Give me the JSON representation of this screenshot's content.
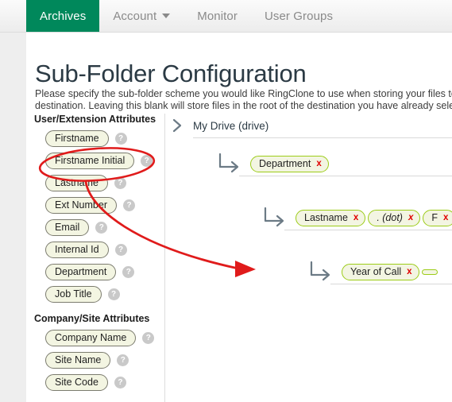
{
  "nav": {
    "items": [
      {
        "label": "Archives",
        "active": true,
        "has_caret": false
      },
      {
        "label": "Account",
        "active": false,
        "has_caret": true
      },
      {
        "label": "Monitor",
        "active": false,
        "has_caret": false
      },
      {
        "label": "User Groups",
        "active": false,
        "has_caret": false
      }
    ],
    "active_color": "#00885b"
  },
  "page": {
    "title": "Sub-Folder Configuration",
    "description": "Please specify the sub-folder scheme you would like RingClone to use when storing your files to your destination. Leaving this blank will store files in the root of the destination you have already selected."
  },
  "sidebar": {
    "groups": [
      {
        "title": "User/Extension Attributes",
        "items": [
          {
            "label": "Firstname",
            "help": "?"
          },
          {
            "label": "Firstname Initial",
            "help": "?"
          },
          {
            "label": "Lastname",
            "help": "?"
          },
          {
            "label": "Ext Number",
            "help": "?"
          },
          {
            "label": "Email",
            "help": "?"
          },
          {
            "label": "Internal Id",
            "help": "?"
          },
          {
            "label": "Department",
            "help": "?"
          },
          {
            "label": "Job Title",
            "help": "?"
          }
        ]
      },
      {
        "title": "Company/Site Attributes",
        "items": [
          {
            "label": "Company Name",
            "help": "?"
          },
          {
            "label": "Site Name",
            "help": "?"
          },
          {
            "label": "Site Code",
            "help": "?"
          }
        ]
      }
    ]
  },
  "tree": {
    "root": {
      "label": "My Drive (drive)"
    },
    "rows": [
      {
        "tags": [
          {
            "label": "Department",
            "remove": "x",
            "italic": false
          }
        ]
      },
      {
        "tags": [
          {
            "label": "Lastname",
            "remove": "x",
            "italic": false
          },
          {
            "label": ". (dot)",
            "remove": "x",
            "italic": true
          },
          {
            "label": "F",
            "remove": "x",
            "italic": false
          }
        ]
      },
      {
        "tags": [
          {
            "label": "Year of Call",
            "remove": "x",
            "italic": false
          },
          {
            "label": "",
            "remove": "",
            "italic": false
          }
        ]
      }
    ]
  },
  "annotation": {
    "highlight_target": "Firstname Initial",
    "arrow_target": "Lastname tag row",
    "color": "#e01b1b"
  }
}
